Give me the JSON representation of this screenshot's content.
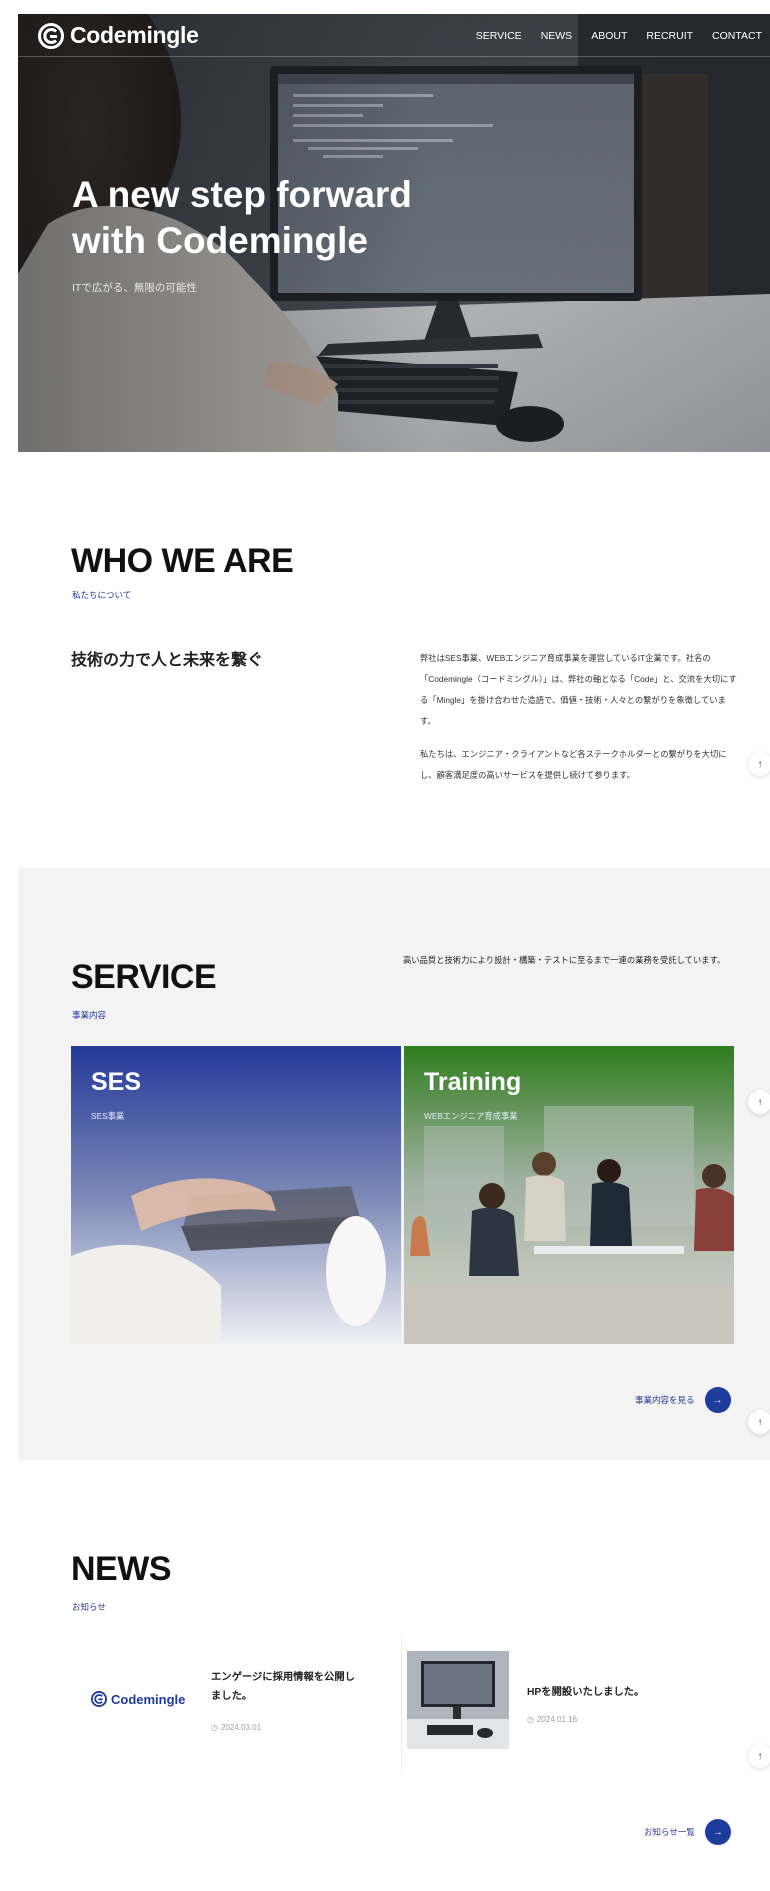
{
  "brand": {
    "name": "Codemingle"
  },
  "nav": {
    "items": [
      "SERVICE",
      "NEWS",
      "ABOUT",
      "RECRUIT",
      "CONTACT"
    ]
  },
  "hero": {
    "title_line1": "A new step forward",
    "title_line2": "with Codemingle",
    "subtitle": "ITで広がる、無限の可能性"
  },
  "who": {
    "title": "WHO WE ARE",
    "subtitle": "私たちについて",
    "lead": "技術の力で人と未来を繋ぐ",
    "body": [
      "弊社はSES事業、WEBエンジニア育成事業を運営しているIT企業です。社名の「Codemingle（コードミングル）」は、弊社の軸となる「Code」と、交流を大切にする「Mingle」を掛け合わせた造語で、価値・技術・人々との繋がりを象徴しています。",
      "私たちは、エンジニア・クライアントなど各ステークホルダーとの繋がりを大切にし、顧客満足度の高いサービスを提供し続けて参ります。"
    ]
  },
  "service": {
    "title": "SERVICE",
    "subtitle": "事業内容",
    "description": "高い品質と技術力により設計・構築・テストに至るまで一連の業務を受託しています。",
    "cards": [
      {
        "title": "SES",
        "subtitle": "SES事業"
      },
      {
        "title": "Training",
        "subtitle": "WEBエンジニア育成事業"
      }
    ],
    "more_label": "事業内容を見る"
  },
  "news": {
    "title": "NEWS",
    "subtitle": "お知らせ",
    "items": [
      {
        "title": "エンゲージに採用情報を公開しました。",
        "date": "2024.03.01"
      },
      {
        "title": "HPを開設いたしました。",
        "date": "2024.01.16"
      }
    ],
    "more_label": "お知らせ一覧"
  },
  "icons": {
    "back_to_top": "arrow-up-icon",
    "more": "arrow-right-icon",
    "date": "clock-icon"
  },
  "colors": {
    "accent": "#1f3b9c",
    "service_bg": "#f3f3f3",
    "training_green": "#2f7d1c"
  }
}
